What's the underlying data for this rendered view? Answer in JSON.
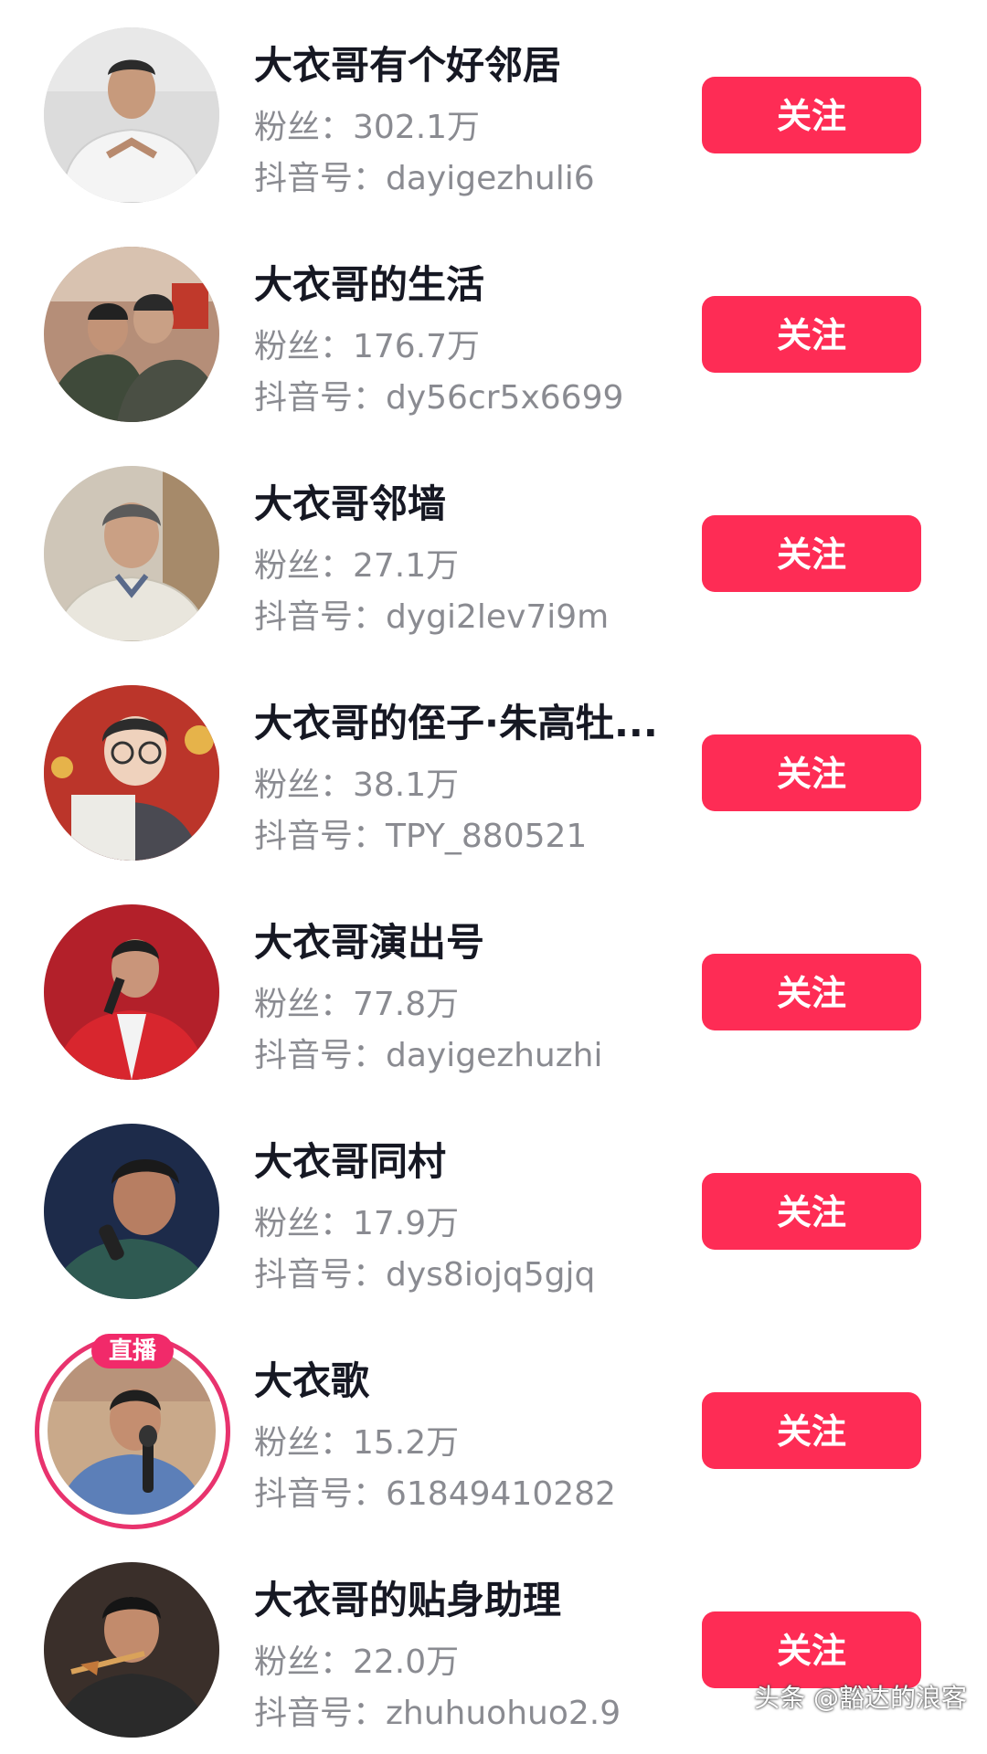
{
  "follow_label": "关注",
  "live_label": "直播",
  "watermark": "头条 @豁达的浪客",
  "users": [
    {
      "name": "大衣哥有个好邻居",
      "fans": "粉丝：302.1万",
      "douyin_id": "抖音号：dayigezhuli6"
    },
    {
      "name": "大衣哥的生活",
      "fans": "粉丝：176.7万",
      "douyin_id": "抖音号：dy56cr5x6699"
    },
    {
      "name": "大衣哥邻墙",
      "fans": "粉丝：27.1万",
      "douyin_id": "抖音号：dygi2lev7i9m"
    },
    {
      "name": "大衣哥的侄子·朱高牡...",
      "fans": "粉丝：38.1万",
      "douyin_id": "抖音号：TPY_880521"
    },
    {
      "name": "大衣哥演出号",
      "fans": "粉丝：77.8万",
      "douyin_id": "抖音号：dayigezhuzhi"
    },
    {
      "name": "大衣哥同村",
      "fans": "粉丝：17.9万",
      "douyin_id": "抖音号：dys8iojq5gjq"
    },
    {
      "name": "大衣歌",
      "fans": "粉丝：15.2万",
      "douyin_id": "抖音号：61849410282"
    },
    {
      "name": "大衣哥的贴身助理",
      "fans": "粉丝：22.0万",
      "douyin_id": "抖音号：zhuhuohuo2.9"
    }
  ],
  "colors": {
    "follow_button": "#fe2c55",
    "live_ring": "#e8336e",
    "name_text": "#161823",
    "meta_text": "#8a8b91"
  }
}
